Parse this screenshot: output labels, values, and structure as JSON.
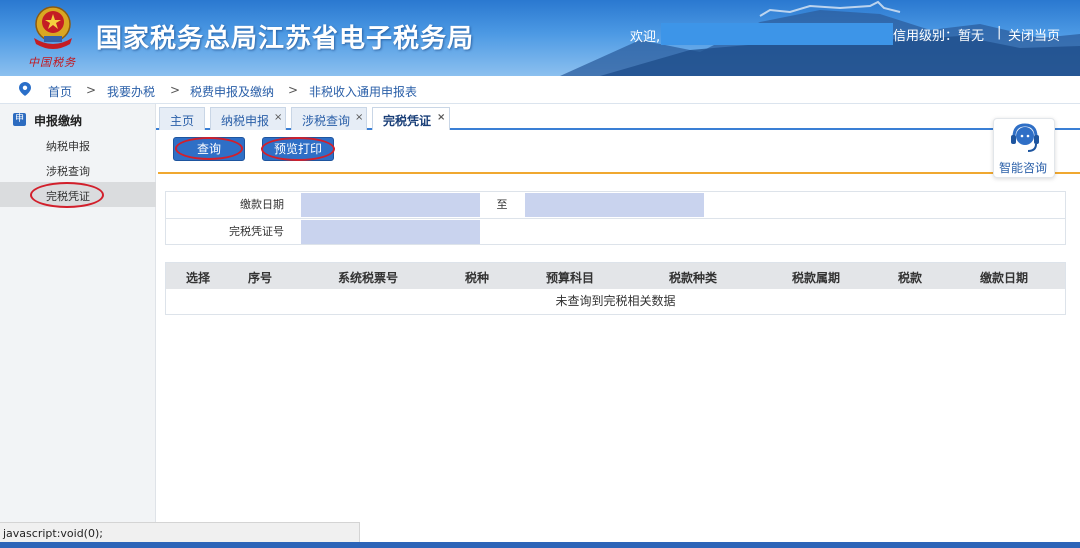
{
  "header": {
    "site_title": "国家税务总局江苏省电子税务局",
    "motto": "中国税务",
    "welcome": "欢迎,",
    "credit_level": "信用级别：暂无",
    "separator": "|",
    "close_page": "关闭当页"
  },
  "breadcrumb": [
    "首页",
    "我要办税",
    "税费申报及缴纳",
    "非税收入通用申报表"
  ],
  "breadcrumb_separator": ">",
  "sidebar": {
    "badge": "申",
    "title": "申报缴纳",
    "items": [
      {
        "label": "纳税申报"
      },
      {
        "label": "涉税查询"
      },
      {
        "label": "完税凭证",
        "active": true
      }
    ]
  },
  "tabs": [
    {
      "label": "主页",
      "closable": false
    },
    {
      "label": "纳税申报",
      "closable": true
    },
    {
      "label": "涉税查询",
      "closable": true
    },
    {
      "label": "完税凭证",
      "closable": true,
      "active": true
    }
  ],
  "tab_close": "×",
  "toolbar": {
    "query_label": "查询",
    "print_label": "预览打印"
  },
  "consult": {
    "label": "智能咨询"
  },
  "form": {
    "pay_date_label": "缴款日期",
    "to_label": "至",
    "certificate_no_label": "完税凭证号",
    "pay_date_from": "",
    "pay_date_to": "",
    "certificate_no": ""
  },
  "table": {
    "columns": [
      "选择",
      "序号",
      "系统税票号",
      "税种",
      "预算科目",
      "税款种类",
      "税款属期",
      "税款",
      "缴款日期"
    ],
    "empty_message": "未查询到完税相关数据"
  },
  "status_bar": "javascript:void(0);",
  "colors": {
    "primary_blue": "#2f6fc6",
    "highlight_red": "#d21f2b",
    "accent_orange": "#f0a830",
    "input_fill": "#c9d3ee"
  }
}
